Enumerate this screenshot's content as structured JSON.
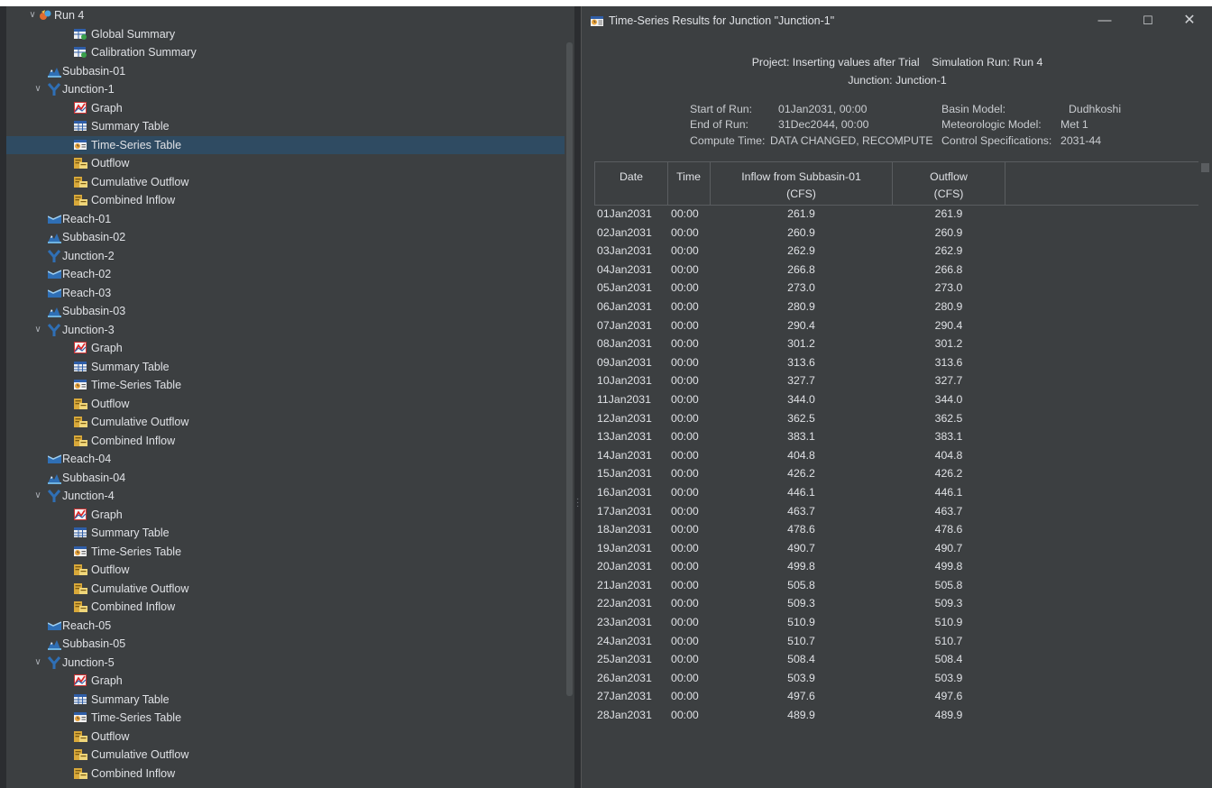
{
  "colors": {
    "background": "#2b2d30",
    "panel": "#3c3f41",
    "selected_row": "#2f4b62",
    "text": "#dfe1e5"
  },
  "tree": {
    "items": [
      {
        "label": "Run 4",
        "level": 0,
        "icon": "run-icon",
        "expanded": true
      },
      {
        "label": "Global Summary",
        "level": 2,
        "icon": "global-summary-icon"
      },
      {
        "label": "Calibration Summary",
        "level": 2,
        "icon": "calibration-summary-icon"
      },
      {
        "label": "Subbasin-01",
        "level": 1,
        "icon": "subbasin-icon"
      },
      {
        "label": "Junction-1",
        "level": 1,
        "icon": "junction-icon",
        "expanded": true
      },
      {
        "label": "Graph",
        "level": 2,
        "icon": "graph-icon"
      },
      {
        "label": "Summary Table",
        "level": 2,
        "icon": "summary-table-icon"
      },
      {
        "label": "Time-Series Table",
        "level": 2,
        "icon": "time-series-table-icon",
        "selected": true
      },
      {
        "label": "Outflow",
        "level": 2,
        "icon": "outflow-icon"
      },
      {
        "label": "Cumulative Outflow",
        "level": 2,
        "icon": "outflow-icon"
      },
      {
        "label": "Combined Inflow",
        "level": 2,
        "icon": "outflow-icon"
      },
      {
        "label": "Reach-01",
        "level": 1,
        "icon": "reach-icon"
      },
      {
        "label": "Subbasin-02",
        "level": 1,
        "icon": "subbasin-icon"
      },
      {
        "label": "Junction-2",
        "level": 1,
        "icon": "junction-icon"
      },
      {
        "label": "Reach-02",
        "level": 1,
        "icon": "reach-icon"
      },
      {
        "label": "Reach-03",
        "level": 1,
        "icon": "reach-icon"
      },
      {
        "label": "Subbasin-03",
        "level": 1,
        "icon": "subbasin-icon"
      },
      {
        "label": "Junction-3",
        "level": 1,
        "icon": "junction-icon",
        "expanded": true
      },
      {
        "label": "Graph",
        "level": 2,
        "icon": "graph-icon"
      },
      {
        "label": "Summary Table",
        "level": 2,
        "icon": "summary-table-icon"
      },
      {
        "label": "Time-Series Table",
        "level": 2,
        "icon": "time-series-table-icon"
      },
      {
        "label": "Outflow",
        "level": 2,
        "icon": "outflow-icon"
      },
      {
        "label": "Cumulative Outflow",
        "level": 2,
        "icon": "outflow-icon"
      },
      {
        "label": "Combined Inflow",
        "level": 2,
        "icon": "outflow-icon"
      },
      {
        "label": "Reach-04",
        "level": 1,
        "icon": "reach-icon"
      },
      {
        "label": "Subbasin-04",
        "level": 1,
        "icon": "subbasin-icon"
      },
      {
        "label": "Junction-4",
        "level": 1,
        "icon": "junction-icon",
        "expanded": true
      },
      {
        "label": "Graph",
        "level": 2,
        "icon": "graph-icon"
      },
      {
        "label": "Summary Table",
        "level": 2,
        "icon": "summary-table-icon"
      },
      {
        "label": "Time-Series Table",
        "level": 2,
        "icon": "time-series-table-icon"
      },
      {
        "label": "Outflow",
        "level": 2,
        "icon": "outflow-icon"
      },
      {
        "label": "Cumulative Outflow",
        "level": 2,
        "icon": "outflow-icon"
      },
      {
        "label": "Combined Inflow",
        "level": 2,
        "icon": "outflow-icon"
      },
      {
        "label": "Reach-05",
        "level": 1,
        "icon": "reach-icon"
      },
      {
        "label": "Subbasin-05",
        "level": 1,
        "icon": "subbasin-icon"
      },
      {
        "label": "Junction-5",
        "level": 1,
        "icon": "junction-icon",
        "expanded": true
      },
      {
        "label": "Graph",
        "level": 2,
        "icon": "graph-icon"
      },
      {
        "label": "Summary Table",
        "level": 2,
        "icon": "summary-table-icon"
      },
      {
        "label": "Time-Series Table",
        "level": 2,
        "icon": "time-series-table-icon"
      },
      {
        "label": "Outflow",
        "level": 2,
        "icon": "outflow-icon"
      },
      {
        "label": "Cumulative Outflow",
        "level": 2,
        "icon": "outflow-icon"
      },
      {
        "label": "Combined Inflow",
        "level": 2,
        "icon": "outflow-icon"
      }
    ]
  },
  "window": {
    "title": "Time-Series Results for Junction \"Junction-1\"",
    "minimize": "—",
    "maximize": "☐",
    "close": "✕"
  },
  "header": {
    "project_line": "Project: Inserting values after Trial    Simulation Run: Run 4",
    "junction_line": "Junction: Junction-1",
    "start_of_run_label": "Start of Run:",
    "start_of_run_value": "01Jan2031, 00:00",
    "end_of_run_label": "End of Run:",
    "end_of_run_value": "31Dec2044, 00:00",
    "compute_time_label": "Compute Time:",
    "compute_time_value": "DATA CHANGED, RECOMPUTE",
    "basin_model_label": "Basin Model:",
    "basin_model_value": "Dudhkoshi",
    "met_model_label": "Meteorologic Model:",
    "met_model_value": "Met 1",
    "control_spec_label": "Control Specifications:",
    "control_spec_value": "2031-44"
  },
  "table": {
    "columns": [
      {
        "line1": "Date",
        "line2": ""
      },
      {
        "line1": "Time",
        "line2": ""
      },
      {
        "line1": "Inflow from Subbasin-01",
        "line2": "(CFS)"
      },
      {
        "line1": "Outflow",
        "line2": "(CFS)"
      }
    ],
    "rows": [
      {
        "date": "01Jan2031",
        "time": "00:00",
        "inflow": "261.9",
        "outflow": "261.9"
      },
      {
        "date": "02Jan2031",
        "time": "00:00",
        "inflow": "260.9",
        "outflow": "260.9"
      },
      {
        "date": "03Jan2031",
        "time": "00:00",
        "inflow": "262.9",
        "outflow": "262.9"
      },
      {
        "date": "04Jan2031",
        "time": "00:00",
        "inflow": "266.8",
        "outflow": "266.8"
      },
      {
        "date": "05Jan2031",
        "time": "00:00",
        "inflow": "273.0",
        "outflow": "273.0"
      },
      {
        "date": "06Jan2031",
        "time": "00:00",
        "inflow": "280.9",
        "outflow": "280.9"
      },
      {
        "date": "07Jan2031",
        "time": "00:00",
        "inflow": "290.4",
        "outflow": "290.4"
      },
      {
        "date": "08Jan2031",
        "time": "00:00",
        "inflow": "301.2",
        "outflow": "301.2"
      },
      {
        "date": "09Jan2031",
        "time": "00:00",
        "inflow": "313.6",
        "outflow": "313.6"
      },
      {
        "date": "10Jan2031",
        "time": "00:00",
        "inflow": "327.7",
        "outflow": "327.7"
      },
      {
        "date": "11Jan2031",
        "time": "00:00",
        "inflow": "344.0",
        "outflow": "344.0"
      },
      {
        "date": "12Jan2031",
        "time": "00:00",
        "inflow": "362.5",
        "outflow": "362.5"
      },
      {
        "date": "13Jan2031",
        "time": "00:00",
        "inflow": "383.1",
        "outflow": "383.1"
      },
      {
        "date": "14Jan2031",
        "time": "00:00",
        "inflow": "404.8",
        "outflow": "404.8"
      },
      {
        "date": "15Jan2031",
        "time": "00:00",
        "inflow": "426.2",
        "outflow": "426.2"
      },
      {
        "date": "16Jan2031",
        "time": "00:00",
        "inflow": "446.1",
        "outflow": "446.1"
      },
      {
        "date": "17Jan2031",
        "time": "00:00",
        "inflow": "463.7",
        "outflow": "463.7"
      },
      {
        "date": "18Jan2031",
        "time": "00:00",
        "inflow": "478.6",
        "outflow": "478.6"
      },
      {
        "date": "19Jan2031",
        "time": "00:00",
        "inflow": "490.7",
        "outflow": "490.7"
      },
      {
        "date": "20Jan2031",
        "time": "00:00",
        "inflow": "499.8",
        "outflow": "499.8"
      },
      {
        "date": "21Jan2031",
        "time": "00:00",
        "inflow": "505.8",
        "outflow": "505.8"
      },
      {
        "date": "22Jan2031",
        "time": "00:00",
        "inflow": "509.3",
        "outflow": "509.3"
      },
      {
        "date": "23Jan2031",
        "time": "00:00",
        "inflow": "510.9",
        "outflow": "510.9"
      },
      {
        "date": "24Jan2031",
        "time": "00:00",
        "inflow": "510.7",
        "outflow": "510.7"
      },
      {
        "date": "25Jan2031",
        "time": "00:00",
        "inflow": "508.4",
        "outflow": "508.4"
      },
      {
        "date": "26Jan2031",
        "time": "00:00",
        "inflow": "503.9",
        "outflow": "503.9"
      },
      {
        "date": "27Jan2031",
        "time": "00:00",
        "inflow": "497.6",
        "outflow": "497.6"
      },
      {
        "date": "28Jan2031",
        "time": "00:00",
        "inflow": "489.9",
        "outflow": "489.9"
      }
    ]
  }
}
